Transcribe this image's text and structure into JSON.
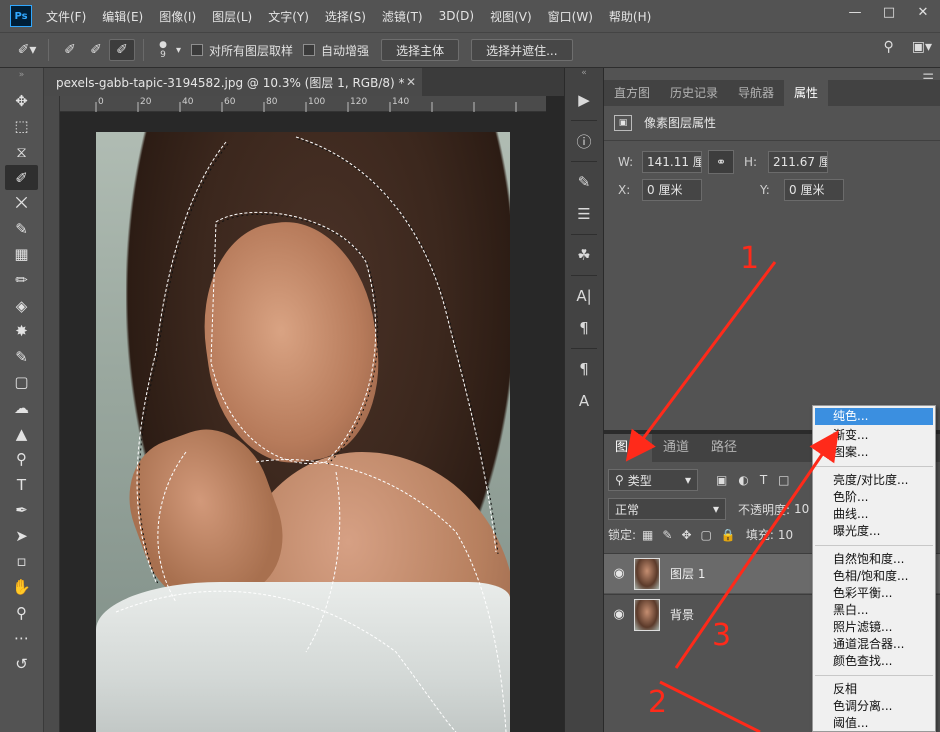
{
  "app": {
    "logo": "Ps"
  },
  "menu": [
    "文件(F)",
    "编辑(E)",
    "图像(I)",
    "图层(L)",
    "文字(Y)",
    "选择(S)",
    "滤镜(T)",
    "3D(D)",
    "视图(V)",
    "窗口(W)",
    "帮助(H)"
  ],
  "options": {
    "brush_size": "9",
    "sample_all_layers": "对所有图层取样",
    "auto_enhance": "自动增强",
    "select_subject": "选择主体",
    "select_and_mask": "选择并遮住..."
  },
  "document": {
    "tab_title": "pexels-gabb-tapic-3194582.jpg @ 10.3% (图层 1, RGB/8) *",
    "ruler_ticks": [
      "0",
      "10",
      "20",
      "30",
      "40",
      "50",
      "60",
      "70",
      "80",
      "90",
      "100",
      "110",
      "120",
      "130",
      "140"
    ]
  },
  "properties_panel": {
    "tabs": [
      "直方图",
      "历史记录",
      "导航器",
      "属性"
    ],
    "active_tab": "属性",
    "title": "像素图层属性",
    "w_label": "W:",
    "w_value": "141.11 厘",
    "h_label": "H:",
    "h_value": "211.67 厘",
    "x_label": "X:",
    "x_value": "0 厘米",
    "y_label": "Y:",
    "y_value": "0 厘米"
  },
  "layers_panel": {
    "tabs": [
      "图层",
      "通道",
      "路径"
    ],
    "active_tab": "图层",
    "filter": "类型",
    "blend_mode": "正常",
    "opacity_label": "不透明度:",
    "opacity_value": "10",
    "lock_label": "锁定:",
    "fill_label": "填充:",
    "fill_value": "10",
    "layers": [
      {
        "name": "图层 1",
        "selected": true
      },
      {
        "name": "背景",
        "selected": false
      }
    ]
  },
  "context_menu": {
    "group1": [
      "纯色...",
      "渐变...",
      "图案..."
    ],
    "group2": [
      "亮度/对比度...",
      "色阶...",
      "曲线...",
      "曝光度..."
    ],
    "group3": [
      "自然饱和度...",
      "色相/饱和度...",
      "色彩平衡...",
      "黑白...",
      "照片滤镜...",
      "通道混合器...",
      "颜色查找..."
    ],
    "group4": [
      "反相",
      "色调分离...",
      "阈值..."
    ],
    "highlighted": "纯色..."
  },
  "annotations": [
    "1",
    "2",
    "3"
  ],
  "colors": {
    "annotation": "#ff2a1a",
    "highlight": "#3b8fe0"
  }
}
